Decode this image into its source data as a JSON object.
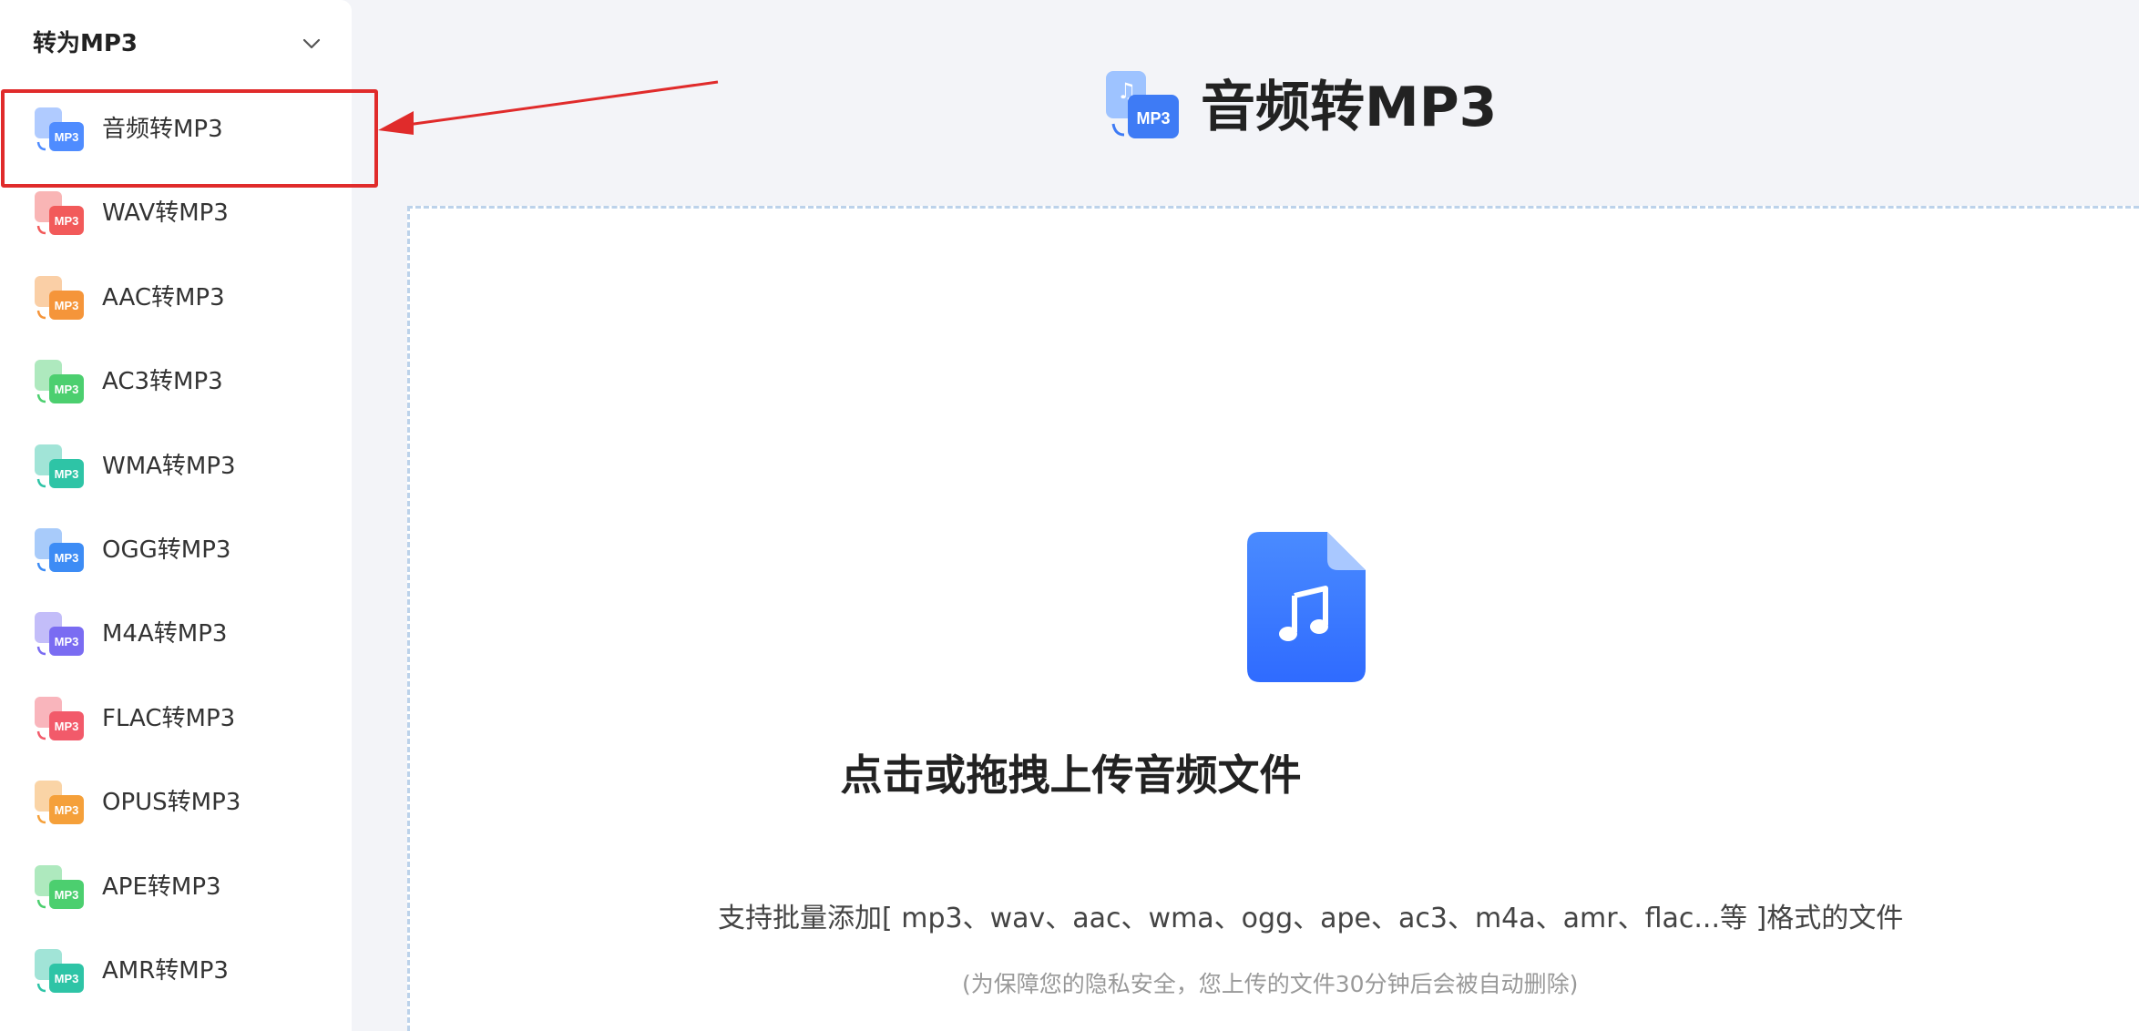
{
  "sidebar": {
    "title": "转为MP3",
    "items": [
      {
        "label": "音频转MP3",
        "color": "#4f8cff",
        "active": true
      },
      {
        "label": "WAV转MP3",
        "color": "#f25a5a"
      },
      {
        "label": "AAC转MP3",
        "color": "#f5953a"
      },
      {
        "label": "AC3转MP3",
        "color": "#4ccf6f"
      },
      {
        "label": "WMA转MP3",
        "color": "#2ec4a6"
      },
      {
        "label": "OGG转MP3",
        "color": "#3d8cf5"
      },
      {
        "label": "M4A转MP3",
        "color": "#7a6cf2"
      },
      {
        "label": "FLAC转MP3",
        "color": "#f25a6a"
      },
      {
        "label": "OPUS转MP3",
        "color": "#f5a03a"
      },
      {
        "label": "APE转MP3",
        "color": "#4ccf6f"
      },
      {
        "label": "AMR转MP3",
        "color": "#2ec4a6"
      }
    ]
  },
  "main": {
    "title": "音频转MP3",
    "upload_title": "点击或拖拽上传音频文件",
    "support_text": "支持批量添加[ mp3、wav、aac、wma、ogg、ape、ac3、m4a、amr、flac...等 ]格式的文件",
    "privacy_text": "(为保障您的隐私安全，您上传的文件30分钟后会被自动删除)"
  },
  "colors": {
    "accent": "#2f6bff",
    "highlight": "#e02b2b"
  }
}
